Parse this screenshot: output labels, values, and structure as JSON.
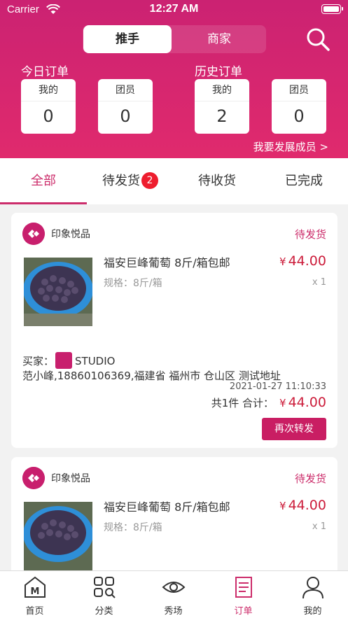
{
  "status_bar": {
    "carrier": "Carrier",
    "time": "12:27 AM"
  },
  "segment": {
    "active": "推手",
    "inactive": "商家"
  },
  "today": {
    "title": "今日订单",
    "mine_label": "我的",
    "mine_value": "0",
    "team_label": "团员",
    "team_value": "0"
  },
  "history": {
    "title": "历史订单",
    "mine_label": "我的",
    "mine_value": "2",
    "team_label": "团员",
    "team_value": "0"
  },
  "expand_link": "我要发展成员 >",
  "tabs": [
    {
      "label": "全部"
    },
    {
      "label": "待发货",
      "badge": "2"
    },
    {
      "label": "待收货"
    },
    {
      "label": "已完成"
    }
  ],
  "orders": [
    {
      "shop": "印象悦品",
      "status": "待发货",
      "product_name": "福安巨峰葡萄  8斤/箱包邮",
      "spec": "规格：8斤/箱",
      "currency": "¥",
      "price": "44.00",
      "qty": "x 1",
      "buyer_label": "买家：",
      "buyer_name": "STUDIO",
      "address": "范小峰,18860106369,福建省 福州市 仓山区 测试地址",
      "datetime": "2021-01-27 11:10:33",
      "count_text": "共1件",
      "total_label": "合计：",
      "total": "44.00",
      "action": "再次转发"
    },
    {
      "shop": "印象悦品",
      "status": "待发货",
      "product_name": "福安巨峰葡萄  8斤/箱包邮",
      "spec": "规格：8斤/箱",
      "currency": "¥",
      "price": "44.00",
      "qty": "x 1"
    }
  ],
  "tabbar": [
    {
      "label": "首页",
      "icon": "home-icon"
    },
    {
      "label": "分类",
      "icon": "category-icon"
    },
    {
      "label": "秀场",
      "icon": "eye-icon"
    },
    {
      "label": "订单",
      "icon": "order-icon"
    },
    {
      "label": "我的",
      "icon": "profile-icon"
    }
  ],
  "colors": {
    "brand": "#cc2d6b",
    "price": "#cc1c3a",
    "badge": "#ee1d2e"
  }
}
